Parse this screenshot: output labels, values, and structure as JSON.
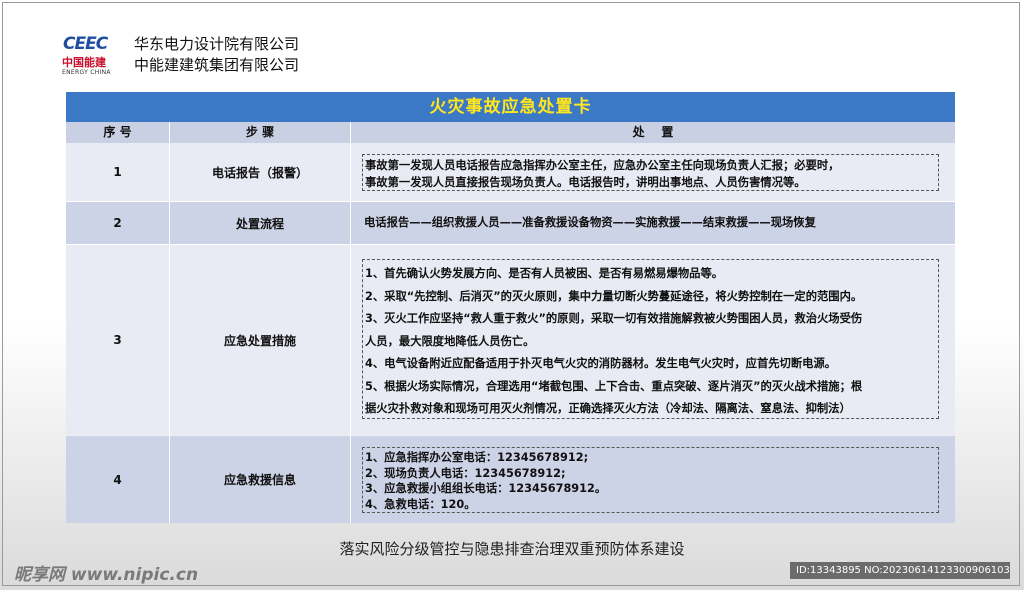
{
  "header": {
    "logo_mark": "CEEC",
    "logo_cn": "中国能建",
    "logo_en": "ENERGY CHINA",
    "org_line1": "华东电力设计院有限公司",
    "org_line2": "中能建建筑集团有限公司"
  },
  "card": {
    "title": "火灾事故应急处置卡",
    "columns": {
      "num": "序 号",
      "step": "步 骤",
      "action": "处    置"
    },
    "rows": [
      {
        "num": "1",
        "step": "电话报告（报警）",
        "lines": [
          "事故第一发现人员电话报告应急指挥办公室主任，应急办公室主任向现场负责人汇报；必要时，",
          "事故第一发现人员直接报告现场负责人。电话报告时，讲明出事地点、人员伤害情况等。"
        ]
      },
      {
        "num": "2",
        "step": "处置流程",
        "lines": [
          "电话报告——组织救援人员——准备救援设备物资——实施救援——结束救援——现场恢复"
        ]
      },
      {
        "num": "3",
        "step": "应急处置措施",
        "lines": [
          "1、首先确认火势发展方向、是否有人员被困、是否有易燃易爆物品等。",
          "2、采取“先控制、后消灭”的灭火原则，集中力量切断火势蔓延途径，将火势控制在一定的范围内。",
          "3、灭火工作应坚持“救人重于救火”的原则，采取一切有效措施解救被火势围困人员，救治火场受伤",
          "人员，最大限度地降低人员伤亡。",
          "4、电气设备附近应配备适用于扑灭电气火灾的消防器材。发生电气火灾时，应首先切断电源。",
          "5、根据火场实际情况，合理选用“堵截包围、上下合击、重点突破、逐片消灭”的灭火战术措施；根",
          "据火灾扑救对象和现场可用灭火剂情况，正确选择灭火方法（冷却法、隔离法、窒息法、抑制法）"
        ]
      },
      {
        "num": "4",
        "step": "应急救援信息",
        "lines": [
          "1、应急指挥办公室电话：12345678912;",
          "2、现场负责人电话：12345678912;",
          "3、应急救援小组组长电话：12345678912。",
          "4、急救电话：120。"
        ]
      }
    ]
  },
  "footer": {
    "slogan": "落实风险分级管控与隐患排查治理双重预防体系建设",
    "watermark_left": "昵享网 www.nipic.cn",
    "watermark_right": "ID:13343895 NO:20230614123300906103"
  },
  "colors": {
    "title_bg": "#3b78c5",
    "title_text": "#ffe61e",
    "header_row_bg": "#c9d0e3",
    "row_light": "#e9ebf4",
    "row_dark": "#cdd3e6"
  }
}
